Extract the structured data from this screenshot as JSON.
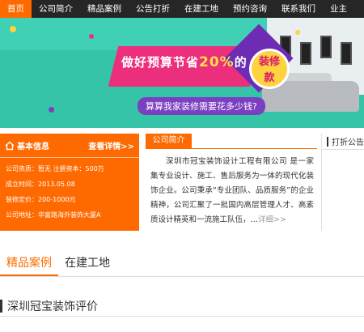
{
  "nav": {
    "items": [
      {
        "label": "首页",
        "active": true
      },
      {
        "label": "公司简介",
        "active": false
      },
      {
        "label": "精品案例",
        "active": false
      },
      {
        "label": "公告打折",
        "active": false
      },
      {
        "label": "在建工地",
        "active": false
      },
      {
        "label": "预约咨询",
        "active": false
      },
      {
        "label": "联系我们",
        "active": false
      },
      {
        "label": "业主",
        "active": false
      }
    ]
  },
  "banner": {
    "headline_a": "做好预算节省",
    "headline_pct": "20%",
    "headline_b": "的",
    "badge_line1": "装修",
    "badge_line2": "款",
    "subtitle": "算算我家装修需要花多少钱?"
  },
  "info": {
    "title": "基本信息",
    "more": "查看详情>>",
    "rows": [
      "公司资质：暂无   注册资本：500万",
      "成立时间：2013.05.08",
      "装修定价：200-1000元",
      "公司地址：华富路海外装饰大厦A"
    ]
  },
  "intro": {
    "tab": "公司简介",
    "body": "深圳市冠宝装饰设计工程有限公司 是一家集专业设计、施工、售后服务为一体的现代化装饰企业。公司秉承“专业团队、品质服务”的企业精神，公司汇聚了一批国内高层管理人才、高素质设计精英和一流施工队伍，…",
    "more": "详细>>"
  },
  "notice": {
    "title": "打折公告"
  },
  "cases": {
    "tabs": [
      {
        "label": "精品案例",
        "active": true
      },
      {
        "label": "在建工地",
        "active": false
      }
    ]
  },
  "evaluation": {
    "title": "深圳冠宝装饰评价"
  },
  "colors": {
    "accent": "#ff6a00",
    "nav_bg": "#262626",
    "banner_teal": "#3fd0b6",
    "banner_pink": "#ec2f7c",
    "banner_purple": "#7b3fc2"
  }
}
